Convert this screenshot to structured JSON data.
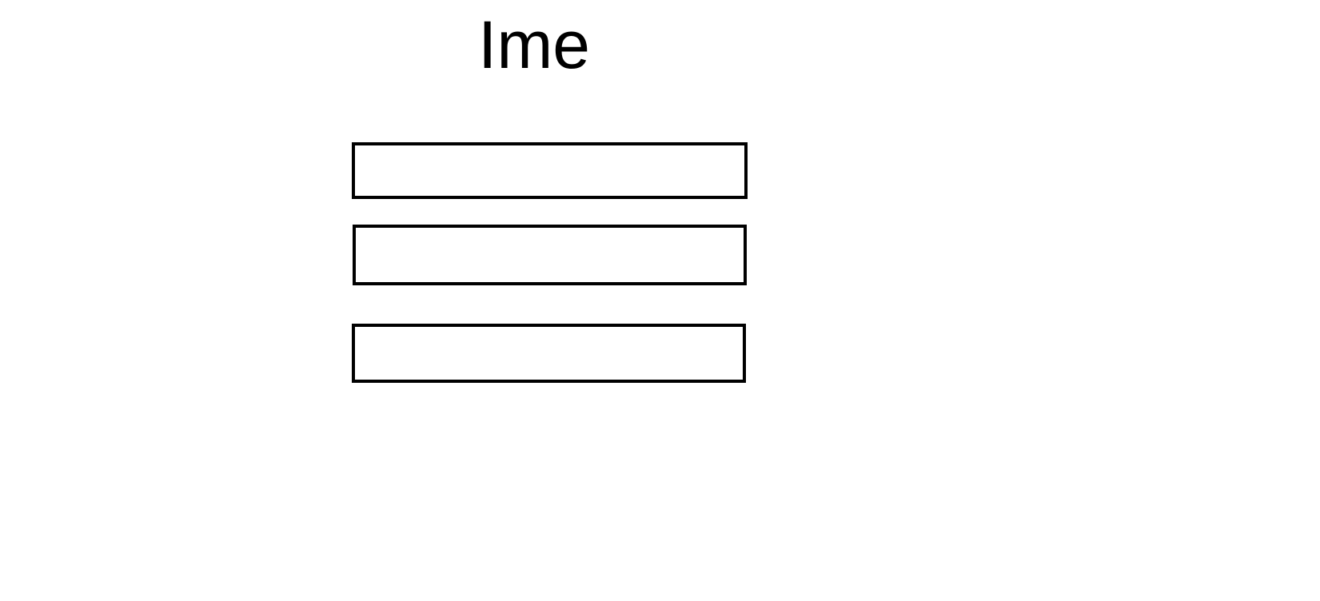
{
  "form": {
    "title": "Ime",
    "fields": [
      {
        "value": "",
        "placeholder": ""
      },
      {
        "value": "",
        "placeholder": ""
      },
      {
        "value": "",
        "placeholder": ""
      }
    ]
  },
  "colors": {
    "background": "#ffffff",
    "foreground": "#000000"
  }
}
